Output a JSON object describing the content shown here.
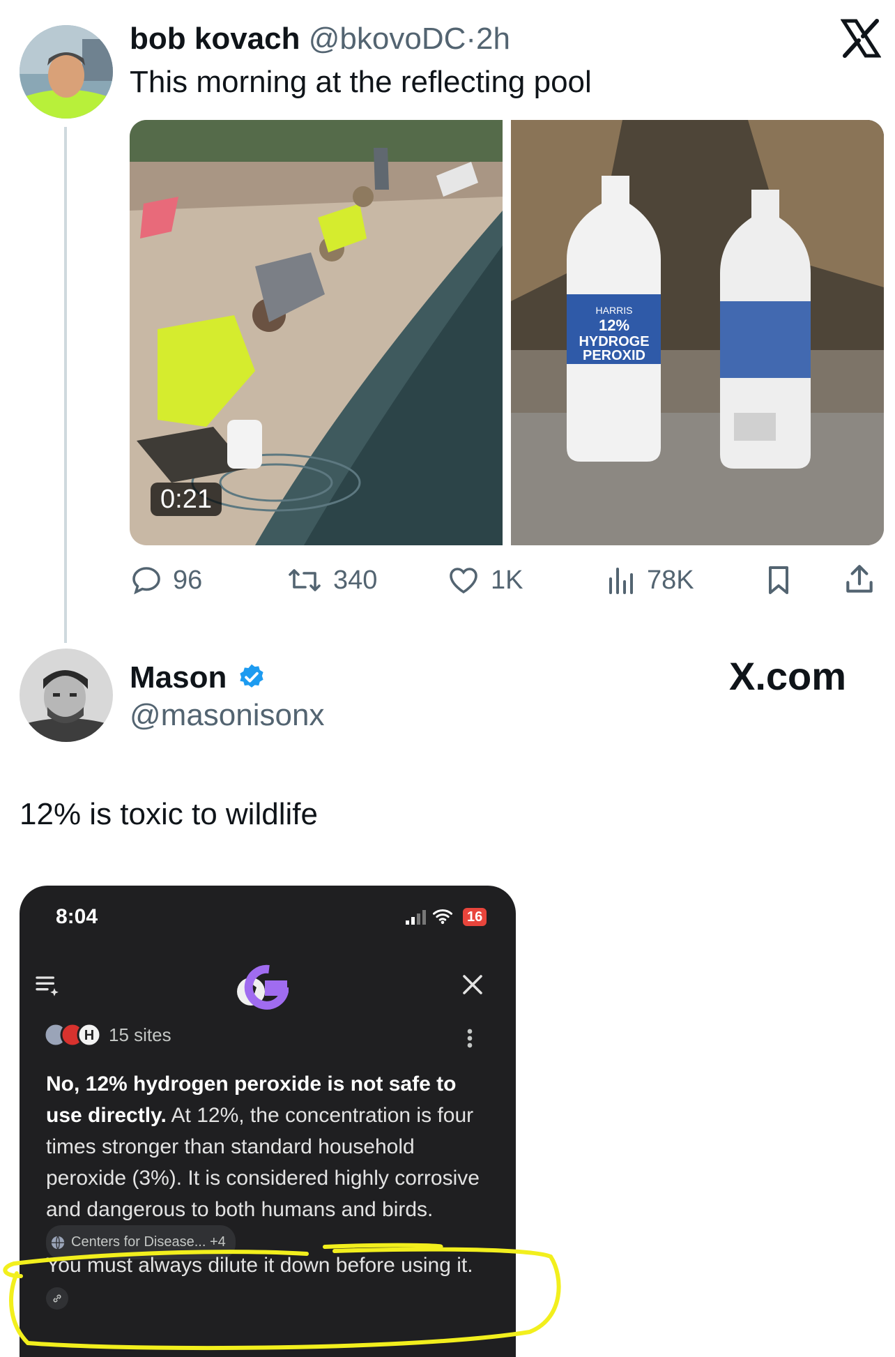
{
  "tweet": {
    "author_name": "bob kovach",
    "author_handle": "@bkovoDC",
    "separator": "·",
    "time": "2h",
    "text": "This morning at the reflecting pool",
    "media": {
      "video_duration": "0:21",
      "bottle_label": [
        "HARRIS",
        "12%",
        "HYDROGE",
        "PEROXID"
      ]
    },
    "actions": {
      "replies": "96",
      "retweets": "340",
      "likes": "1K",
      "views": "78K"
    },
    "icons": [
      "reply-icon",
      "retweet-icon",
      "like-icon",
      "views-icon",
      "bookmark-icon",
      "share-icon",
      "x-logo-icon"
    ]
  },
  "reply": {
    "author_name": "Mason",
    "author_handle": "@masonisonx",
    "site_label": "X.com",
    "text": "12% is toxic to wildlife"
  },
  "screenshot": {
    "time": "8:04",
    "battery": "16",
    "sources_count": "15 sites",
    "answer_bold": "No, 12% hydrogen peroxide is not safe to use directly.",
    "answer_text": " At 12%, the concentration is four times stronger than standard household peroxide (3%). It is considered highly corrosive and dangerous to both humans and birds.",
    "citation_chip": "Centers for Disease... +4",
    "highlighted_text": "You must always dilute it down before using it.",
    "highlight_color": "#f2ef1d"
  }
}
